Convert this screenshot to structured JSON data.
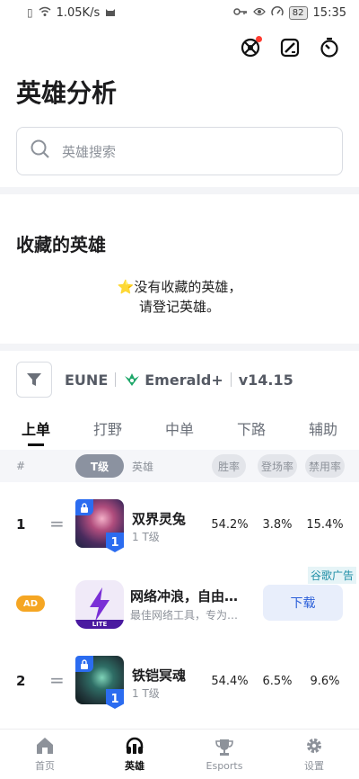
{
  "status_bar": {
    "speed": "1.05K/s",
    "battery": "82",
    "time": "15:35"
  },
  "header": {
    "title": "英雄分析",
    "actions": [
      "target-icon",
      "edit-icon",
      "timer-icon"
    ]
  },
  "search": {
    "placeholder": "英雄搜索"
  },
  "favorites": {
    "title": "收藏的英雄",
    "empty_line1": "⭐没有收藏的英雄，",
    "empty_line2": "请登记英雄。"
  },
  "filter": {
    "region": "EUNE",
    "rank": "Emerald+",
    "version": "v14.15",
    "rank_color": "#1fa76a"
  },
  "tabs": [
    {
      "label": "上单",
      "active": true
    },
    {
      "label": "打野",
      "active": false
    },
    {
      "label": "中单",
      "active": false
    },
    {
      "label": "下路",
      "active": false
    },
    {
      "label": "辅助",
      "active": false
    }
  ],
  "table": {
    "headers": {
      "rank": "#",
      "tier": "T级",
      "hero": "英雄",
      "win_rate": "胜率",
      "pick_rate": "登场率",
      "ban_rate": "禁用率"
    },
    "rows": [
      {
        "rank": "1",
        "trend": "=",
        "tier_badge": "1",
        "name": "双界灵兔",
        "tier_text": "1 T级",
        "win_rate": "54.2%",
        "pick_rate": "3.8%",
        "ban_rate": "15.4%"
      },
      {
        "rank": "2",
        "trend": "=",
        "tier_badge": "1",
        "name": "铁铠冥魂",
        "tier_text": "1 T级",
        "win_rate": "54.4%",
        "pick_rate": "6.5%",
        "ban_rate": "9.6%"
      }
    ]
  },
  "ad": {
    "badge": "AD",
    "tag": "谷歌广告",
    "title": "网络冲浪，自由…",
    "subtitle": "最佳网络工具，专为…",
    "icon_label": "LITE",
    "button": "下载"
  },
  "bottom_nav": [
    {
      "label": "首页",
      "icon": "home-icon",
      "active": false
    },
    {
      "label": "英雄",
      "icon": "headset-icon",
      "active": true
    },
    {
      "label": "Esports",
      "icon": "trophy-icon",
      "active": false
    },
    {
      "label": "设置",
      "icon": "gear-icon",
      "active": false
    }
  ]
}
